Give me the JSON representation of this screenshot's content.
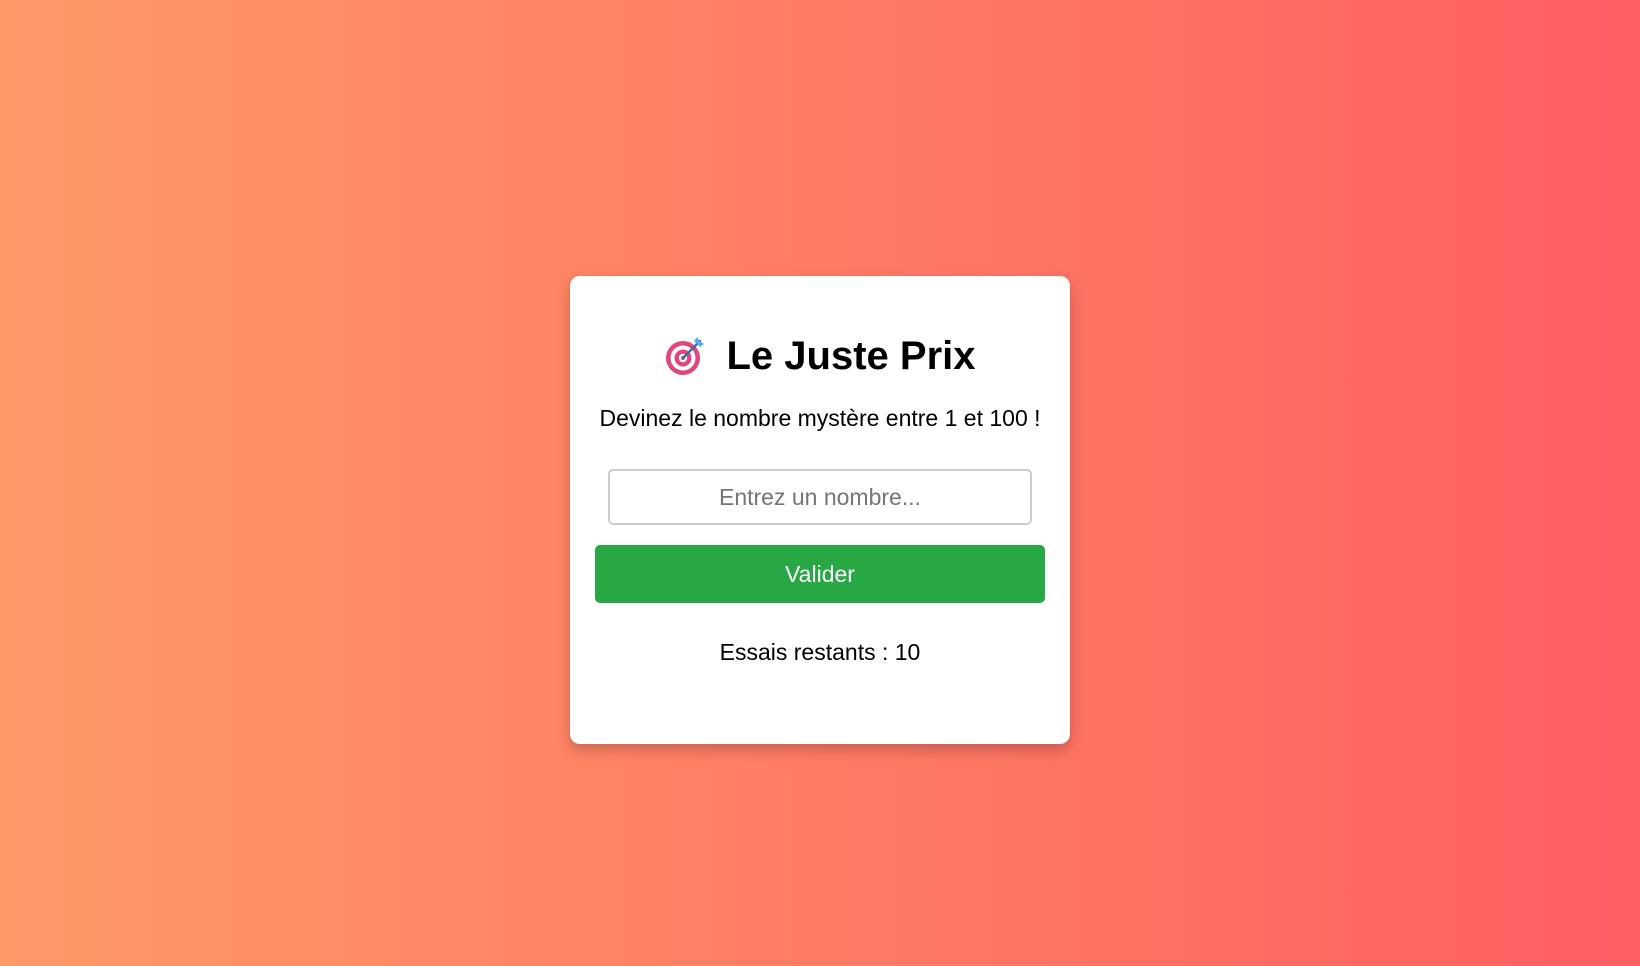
{
  "game": {
    "title_icon": "direct-hit-target-icon",
    "title": "Le Juste Prix",
    "instructions": "Devinez le nombre mystère entre 1 et 100 !",
    "input": {
      "value": "",
      "placeholder": "Entrez un nombre..."
    },
    "submit_label": "Valider",
    "attempts_text": "Essais restants : 10"
  },
  "colors": {
    "background_gradient_start": "#ff9966",
    "background_gradient_end": "#ff5e62",
    "button": "#28a745"
  }
}
